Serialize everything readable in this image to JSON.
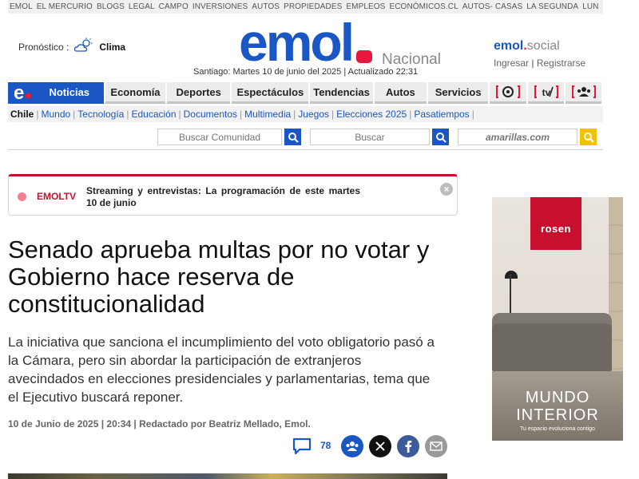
{
  "topbar": {
    "links": [
      "EMOL",
      "EL MERCURIO",
      "BLOGS",
      "LEGAL",
      "CAMPO",
      "INVERSIONES",
      "AUTOS",
      "PROPIEDADES",
      "EMPLEOS",
      "ECONÓMICOS.CL",
      "AUTOS- CASAS",
      "LA SEGUNDA",
      "LUN"
    ]
  },
  "forecast": {
    "label": "Pronóstico :",
    "icon": "partly-cloudy-icon",
    "link": "Clima"
  },
  "header": {
    "logo": "emol",
    "section": "Nacional",
    "dateline": "Santiago: Martes 10 de junio del 2025 | Actualizado 22:31"
  },
  "social": {
    "brand": "emol",
    "brand_suffix": "social",
    "login": "Ingresar",
    "separator": "|",
    "register": "Registrarse"
  },
  "nav": {
    "items": [
      "Noticias",
      "Economía",
      "Deportes",
      "Espectáculos",
      "Tendencias",
      "Autos",
      "Servicios"
    ],
    "active": "Noticias",
    "icon_items": [
      "radio-icon",
      "tv-icon",
      "community-icon"
    ]
  },
  "subnav": {
    "items": [
      "Chile",
      "Mundo",
      "Tecnología",
      "Educación",
      "Documentos",
      "Multimedia",
      "Juegos",
      "Elecciones 2025",
      "Pasatiempos"
    ],
    "active": "Chile"
  },
  "search": {
    "community_placeholder": "Buscar Comunidad",
    "main_placeholder": "Buscar",
    "amarillas_placeholder": "amarillas.com"
  },
  "emoltv": {
    "label": "EMOLTV",
    "text": "Streaming y entrevistas: La programación de este martes 10 de junio",
    "close": "×"
  },
  "article": {
    "headline": "Senado aprueba multas por no votar y Gobierno hace reserva de constitucionalidad",
    "lead": "La iniciativa que sanciona el incumplimiento del voto obligatorio pasó a la Cámara, pero sin abordar la participación de extranjeros avecindados en elecciones presidenciales y parlamentarias, tema que el Ejecutivo buscará reponer.",
    "byline": "10 de Junio de 2025 | 20:34 | Redactado por Beatriz Mellado, Emol.",
    "comments_count": "78"
  },
  "ad": {
    "brand": "rosen",
    "title_line1": "MUNDO",
    "title_line2": "INTERIOR",
    "tagline": "Tu espacio evoluciona contigo"
  },
  "colors": {
    "brand_blue": "#1a56c4",
    "brand_red": "#e8173d",
    "tv_red": "#c8102e"
  }
}
